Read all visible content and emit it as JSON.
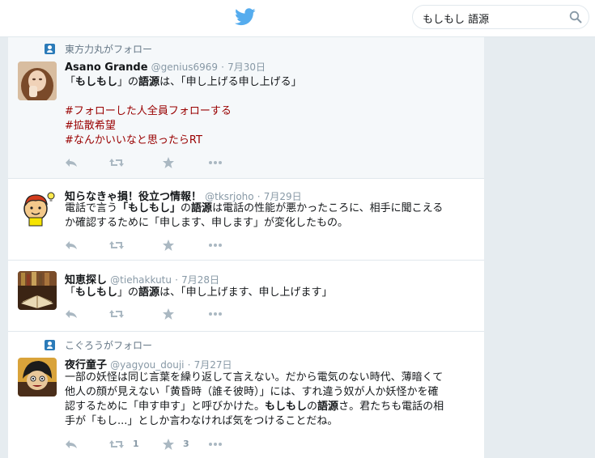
{
  "topbar": {
    "logo": "twitter-bird-icon",
    "search": {
      "value": "もしもし 語源",
      "icon": "search-icon"
    }
  },
  "colors": {
    "accent": "#55acee",
    "hashtag": "#990000",
    "secondary": "#8899a6"
  },
  "tweets": [
    {
      "context": "東方力丸がフォロー",
      "name": "Asano Grande",
      "handle": "@genius6969",
      "dot": "·",
      "date": "7月30日",
      "body": [
        [
          {
            "t": "「"
          },
          {
            "t": "もしもし",
            "b": true
          },
          {
            "t": "」の"
          },
          {
            "t": "語源",
            "b": true
          },
          {
            "t": "は、「申し上げる申し上げる」"
          }
        ],
        [
          {
            "t": ""
          }
        ],
        [
          {
            "t": "#フォローした人全員フォローする",
            "tag": true
          }
        ],
        [
          {
            "t": "#拡散希望",
            "tag": true
          }
        ],
        [
          {
            "t": "#なんかいいなと思ったらRT",
            "tag": true
          }
        ]
      ],
      "retweets": "",
      "likes": ""
    },
    {
      "context": "",
      "name": "知らなきゃ損！役立つ情報！",
      "handle": "@tksrjoho",
      "dot": "·",
      "date": "7月29日",
      "body": [
        [
          {
            "t": "電話で言う"
          },
          {
            "t": "「もしもし」",
            "b": true
          },
          {
            "t": "の"
          },
          {
            "t": "語源",
            "b": true
          },
          {
            "t": "は電話の性能が悪かったころに、相手に聞こえる"
          }
        ],
        [
          {
            "t": "か確認するために「申します、申します」が変化したもの。"
          }
        ]
      ],
      "retweets": "",
      "likes": ""
    },
    {
      "context": "",
      "name": "知恵探し",
      "handle": "@tiehakkutu",
      "dot": "·",
      "date": "7月28日",
      "body": [
        [
          {
            "t": "「"
          },
          {
            "t": "もしもし",
            "b": true
          },
          {
            "t": "」の"
          },
          {
            "t": "語源",
            "b": true
          },
          {
            "t": "は、「申し上げます、申し上げます」"
          }
        ]
      ],
      "retweets": "",
      "likes": ""
    },
    {
      "context": "こぐろうがフォロー",
      "name": "夜行童子",
      "handle": "@yagyou_douji",
      "dot": "·",
      "date": "7月27日",
      "body": [
        [
          {
            "t": "一部の妖怪は同じ言葉を繰り返して言えない。だから電気のない時代、薄暗くて"
          }
        ],
        [
          {
            "t": "他人の顔が見えない「黄昏時（誰そ彼時）」には、すれ違う奴が人か妖怪かを確"
          }
        ],
        [
          {
            "t": "認するために「申す申す」と呼びかけた。"
          },
          {
            "t": "もしもし",
            "b": true
          },
          {
            "t": "の"
          },
          {
            "t": "語源",
            "b": true
          },
          {
            "t": "さ。君たちも電話の相"
          }
        ],
        [
          {
            "t": "手が「もし...」としか言わなければ気をつけることだね。"
          }
        ]
      ],
      "retweets": "1",
      "likes": "3"
    }
  ]
}
